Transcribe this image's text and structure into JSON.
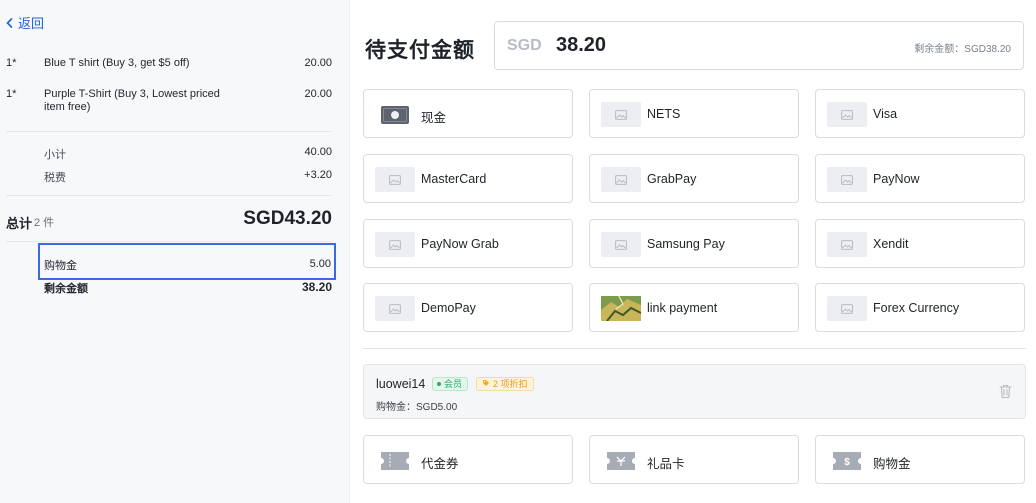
{
  "back_label": "返回",
  "order": {
    "items": [
      {
        "qty": "1*",
        "name": "Blue T shirt (Buy 3, get $5 off)",
        "price": "20.00"
      },
      {
        "qty": "1*",
        "name": "Purple T-Shirt (Buy 3, Lowest priced item free)",
        "price": "20.00"
      }
    ],
    "subtotal_label": "小计",
    "subtotal": "40.00",
    "tax_label": "税费",
    "tax": "+3.20",
    "total_label": "总计",
    "total_count": "2 件",
    "total": "SGD43.20",
    "store_credit_label": "购物金",
    "store_credit": "5.00",
    "remaining_label": "剩余金额",
    "remaining": "38.20"
  },
  "payment": {
    "title": "待支付金额",
    "currency": "SGD",
    "amount": "38.20",
    "remaining_text": "剩余金额：SGD38.20",
    "methods": [
      {
        "label": "现金",
        "icon": "cash-icon"
      },
      {
        "label": "NETS",
        "icon": "image-placeholder-icon"
      },
      {
        "label": "Visa",
        "icon": "image-placeholder-icon"
      },
      {
        "label": "MasterCard",
        "icon": "image-placeholder-icon"
      },
      {
        "label": "GrabPay",
        "icon": "image-placeholder-icon"
      },
      {
        "label": "PayNow",
        "icon": "image-placeholder-icon"
      },
      {
        "label": "PayNow Grab",
        "icon": "image-placeholder-icon"
      },
      {
        "label": "Samsung Pay",
        "icon": "image-placeholder-icon"
      },
      {
        "label": "Xendit",
        "icon": "image-placeholder-icon"
      },
      {
        "label": "DemoPay",
        "icon": "image-placeholder-icon"
      },
      {
        "label": "link payment",
        "icon": "map-thumbnail-icon"
      },
      {
        "label": "Forex Currency",
        "icon": "image-placeholder-icon"
      }
    ]
  },
  "member": {
    "username": "luowei14",
    "member_badge": "会员",
    "discount_badge": "2 项折扣",
    "credit_text": "购物金：SGD5.00"
  },
  "extras": [
    {
      "label": "代金券",
      "icon": "voucher-icon"
    },
    {
      "label": "礼品卡",
      "icon": "gift-card-icon"
    },
    {
      "label": "购物金",
      "icon": "store-credit-icon"
    }
  ],
  "colors": {
    "accent": "#1b62d6",
    "highlight_border": "#3d6ae0",
    "member_green": "#2ea86a",
    "discount_orange": "#e59b1a"
  }
}
